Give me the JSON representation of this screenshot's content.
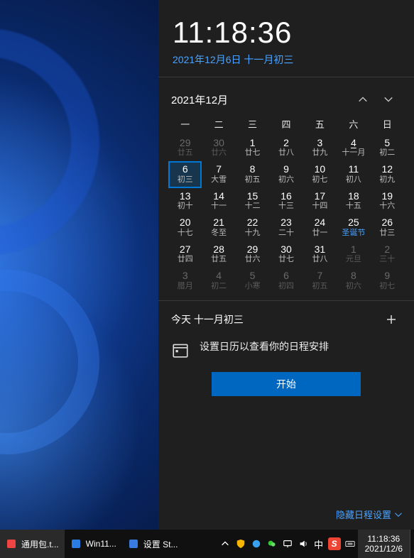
{
  "clock": {
    "time": "11:18:36",
    "date_line": "2021年12月6日 十一月初三"
  },
  "calendar": {
    "title": "2021年12月",
    "dow": [
      "一",
      "二",
      "三",
      "四",
      "五",
      "六",
      "日"
    ],
    "weeks": [
      [
        {
          "n": "29",
          "s": "廿五",
          "dim": true
        },
        {
          "n": "30",
          "s": "廿六",
          "dim": true
        },
        {
          "n": "1",
          "s": "廿七"
        },
        {
          "n": "2",
          "s": "廿八"
        },
        {
          "n": "3",
          "s": "廿九"
        },
        {
          "n": "4",
          "s": "十一月",
          "u": true
        },
        {
          "n": "5",
          "s": "初二"
        }
      ],
      [
        {
          "n": "6",
          "s": "初三",
          "today": true
        },
        {
          "n": "7",
          "s": "大雪"
        },
        {
          "n": "8",
          "s": "初五"
        },
        {
          "n": "9",
          "s": "初六"
        },
        {
          "n": "10",
          "s": "初七"
        },
        {
          "n": "11",
          "s": "初八"
        },
        {
          "n": "12",
          "s": "初九"
        }
      ],
      [
        {
          "n": "13",
          "s": "初十"
        },
        {
          "n": "14",
          "s": "十一"
        },
        {
          "n": "15",
          "s": "十二"
        },
        {
          "n": "16",
          "s": "十三"
        },
        {
          "n": "17",
          "s": "十四"
        },
        {
          "n": "18",
          "s": "十五"
        },
        {
          "n": "19",
          "s": "十六"
        }
      ],
      [
        {
          "n": "20",
          "s": "十七"
        },
        {
          "n": "21",
          "s": "冬至"
        },
        {
          "n": "22",
          "s": "十九"
        },
        {
          "n": "23",
          "s": "二十"
        },
        {
          "n": "24",
          "s": "廿一"
        },
        {
          "n": "25",
          "s": "圣诞节",
          "holiday": true
        },
        {
          "n": "26",
          "s": "廿三"
        }
      ],
      [
        {
          "n": "27",
          "s": "廿四"
        },
        {
          "n": "28",
          "s": "廿五"
        },
        {
          "n": "29",
          "s": "廿六"
        },
        {
          "n": "30",
          "s": "廿七"
        },
        {
          "n": "31",
          "s": "廿八"
        },
        {
          "n": "1",
          "s": "元旦",
          "dim": true
        },
        {
          "n": "2",
          "s": "三十",
          "dim": true
        }
      ],
      [
        {
          "n": "3",
          "s": "腊月",
          "dim": true
        },
        {
          "n": "4",
          "s": "初二",
          "dim": true
        },
        {
          "n": "5",
          "s": "小寒",
          "dim": true
        },
        {
          "n": "6",
          "s": "初四",
          "dim": true
        },
        {
          "n": "7",
          "s": "初五",
          "dim": true
        },
        {
          "n": "8",
          "s": "初六",
          "dim": true
        },
        {
          "n": "9",
          "s": "初七",
          "dim": true
        }
      ]
    ]
  },
  "agenda": {
    "today_label": "今天 十一月初三",
    "setup_text": "设置日历以查看你的日程安排",
    "start_label": "开始",
    "hide_label": "隐藏日程设置"
  },
  "taskbar": {
    "items": [
      {
        "label": "通用包.t...",
        "color": "#e44"
      },
      {
        "label": "Win11...",
        "color": "#2a7de1"
      },
      {
        "label": "设置 St...",
        "color": "#3a7be0"
      }
    ],
    "ime": "中",
    "sogou": "S",
    "clock_time": "11:18:36",
    "clock_date": "2021/12/6"
  }
}
